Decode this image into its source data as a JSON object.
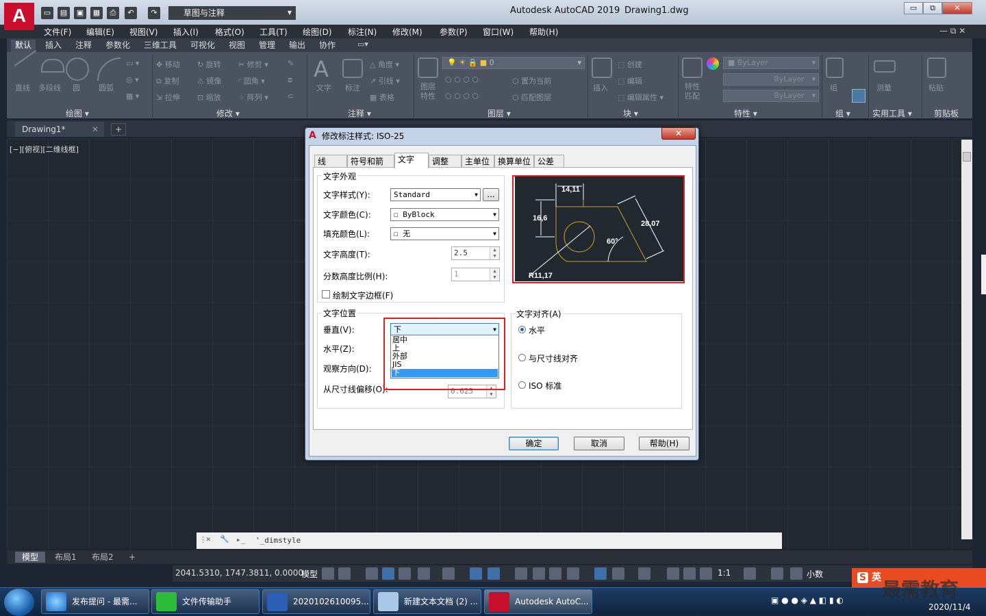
{
  "title_bar": {
    "workspace": "草图与注释",
    "app_title": "Autodesk AutoCAD 2019",
    "document": "Drawing1.dwg",
    "minimize": "▭",
    "restore": "⧉",
    "close": "✕"
  },
  "menu": [
    "文件(F)",
    "编辑(E)",
    "视图(V)",
    "插入(I)",
    "格式(O)",
    "工具(T)",
    "绘图(D)",
    "标注(N)",
    "修改(M)",
    "参数(P)",
    "窗口(W)",
    "帮助(H)"
  ],
  "ribbon_tabs": [
    "默认",
    "插入",
    "注释",
    "参数化",
    "三维工具",
    "可视化",
    "视图",
    "管理",
    "输出",
    "协作"
  ],
  "ribbon": {
    "draw_tools": [
      "直线",
      "多段线",
      "圆",
      "圆弧"
    ],
    "modify_tools": [
      "移动",
      "旋转",
      "修剪",
      "复制",
      "镜像",
      "圆角",
      "拉伸",
      "缩放",
      "阵列"
    ],
    "annot_tools": [
      "文字",
      "标注",
      "角度",
      "引线",
      "表格"
    ],
    "layer_tools": [
      "图层特性",
      "置为当前",
      "匹配图层"
    ],
    "layer_value": "0",
    "block_tools": [
      "插入",
      "创建",
      "编辑",
      "编辑属性"
    ],
    "prop_tools": [
      "特性匹配"
    ],
    "bylayer": [
      "ByLayer",
      "ByLayer",
      "ByLayer"
    ],
    "group_tools": [
      "组"
    ],
    "util_tools": [
      "测量"
    ],
    "clip_tools": [
      "粘贴"
    ],
    "panel_titles": [
      "绘图 ▾",
      "修改 ▾",
      "注释 ▾",
      "图层 ▾",
      "块 ▾",
      "特性 ▾",
      "组 ▾",
      "实用工具 ▾",
      "剪贴板"
    ]
  },
  "doc_tab": "Drawing1*",
  "view_label": "[−][俯视][二维线框]",
  "command_line": "'_dimstyle",
  "layout_tabs": [
    "模型",
    "布局1",
    "布局2"
  ],
  "status": {
    "coords": "2041.5310, 1747.3811, 0.0000",
    "model": "模型",
    "scale": "1:1",
    "units": "小数"
  },
  "dialog": {
    "title": "修改标注样式: ISO-25",
    "close": "✕",
    "tabs": [
      "线",
      "符号和箭头",
      "文字",
      "调整",
      "主单位",
      "换算单位",
      "公差"
    ],
    "appearance": {
      "title": "文字外观",
      "style_label": "文字样式(Y):",
      "style_value": "Standard",
      "style_btn": "...",
      "color_label": "文字颜色(C):",
      "color_value": "ByBlock",
      "fill_label": "填充颜色(L):",
      "fill_value": "无",
      "height_label": "文字高度(T):",
      "height_value": "2.5",
      "frac_label": "分数高度比例(H):",
      "frac_value": "1",
      "frame_label": "绘制文字边框(F)"
    },
    "placement": {
      "title": "文字位置",
      "vertical_label": "垂直(V):",
      "vertical_value": "下",
      "horizontal_label": "水平(Z):",
      "view_label": "观察方向(D):",
      "offset_label": "从尺寸线偏移(O):",
      "offset_value": "0.625",
      "options": [
        "居中",
        "上",
        "外部",
        "JIS",
        "下"
      ]
    },
    "alignment": {
      "title": "文字对齐(A)",
      "options": [
        "水平",
        "与尺寸线对齐",
        "ISO 标准"
      ],
      "selected": "水平"
    },
    "preview": {
      "dim1": "14,11",
      "dim2": "16,6",
      "dim3": "28,07",
      "angle": "60°",
      "radius": "R11,17"
    },
    "buttons": {
      "ok": "确定",
      "cancel": "取消",
      "help": "帮助(H)"
    }
  },
  "taskbar": {
    "items": [
      "发布提问 - 最需...",
      "文件传输助手",
      "2020102610095...",
      "新建文本文档 (2) ...",
      "Autodesk AutoC..."
    ],
    "date": "2020/11/4",
    "watermark": "最需教育",
    "ime": "英"
  },
  "colors": {
    "accent_red": "#e02020",
    "autocad_red": "#c8102e",
    "select_blue": "#3399ff"
  }
}
